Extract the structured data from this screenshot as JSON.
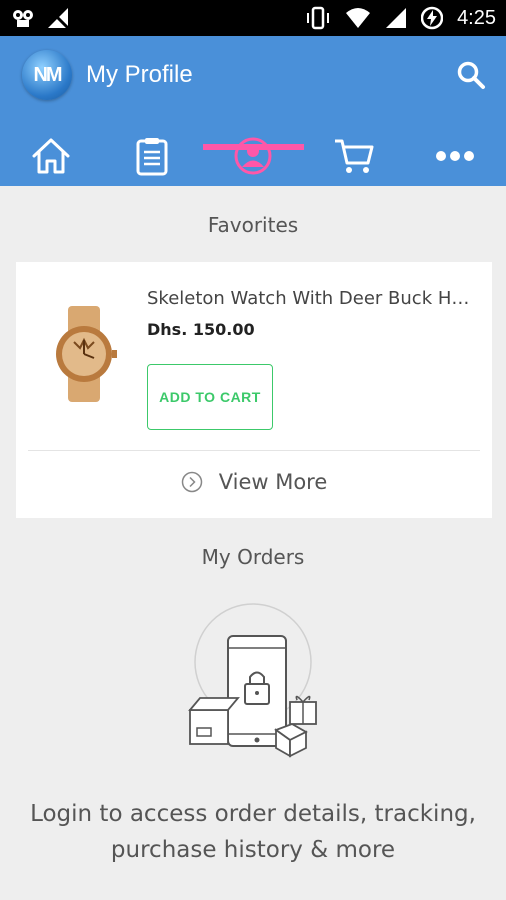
{
  "status_bar": {
    "time": "4:25",
    "icons": [
      "android-debug-icon",
      "no-signal-icon",
      "vibrate-icon",
      "wifi-icon",
      "signal-icon",
      "battery-charging-icon"
    ]
  },
  "app_bar": {
    "logo_text": "NM",
    "title": "My Profile",
    "search_icon": "search-icon"
  },
  "tabs": [
    {
      "name": "home",
      "icon": "home-icon"
    },
    {
      "name": "orders",
      "icon": "clipboard-icon"
    },
    {
      "name": "profile",
      "icon": "profile-icon",
      "selected": true
    },
    {
      "name": "cart",
      "icon": "cart-icon"
    },
    {
      "name": "more",
      "icon": "more-icon"
    }
  ],
  "colors": {
    "app_bar": "#4a90d9",
    "tab_indicator": "#ff57a8",
    "add_to_cart": "#3cc96a",
    "background": "#eeeeee"
  },
  "favorites": {
    "title": "Favorites",
    "product": {
      "name": "Skeleton Watch With Deer Buck Head",
      "price": "Dhs.  150.00",
      "add_to_cart_label": "ADD TO CART"
    },
    "view_more_label": "View More"
  },
  "orders": {
    "title": "My Orders",
    "login_message": "Login to access order details, tracking, purchase history & more"
  }
}
